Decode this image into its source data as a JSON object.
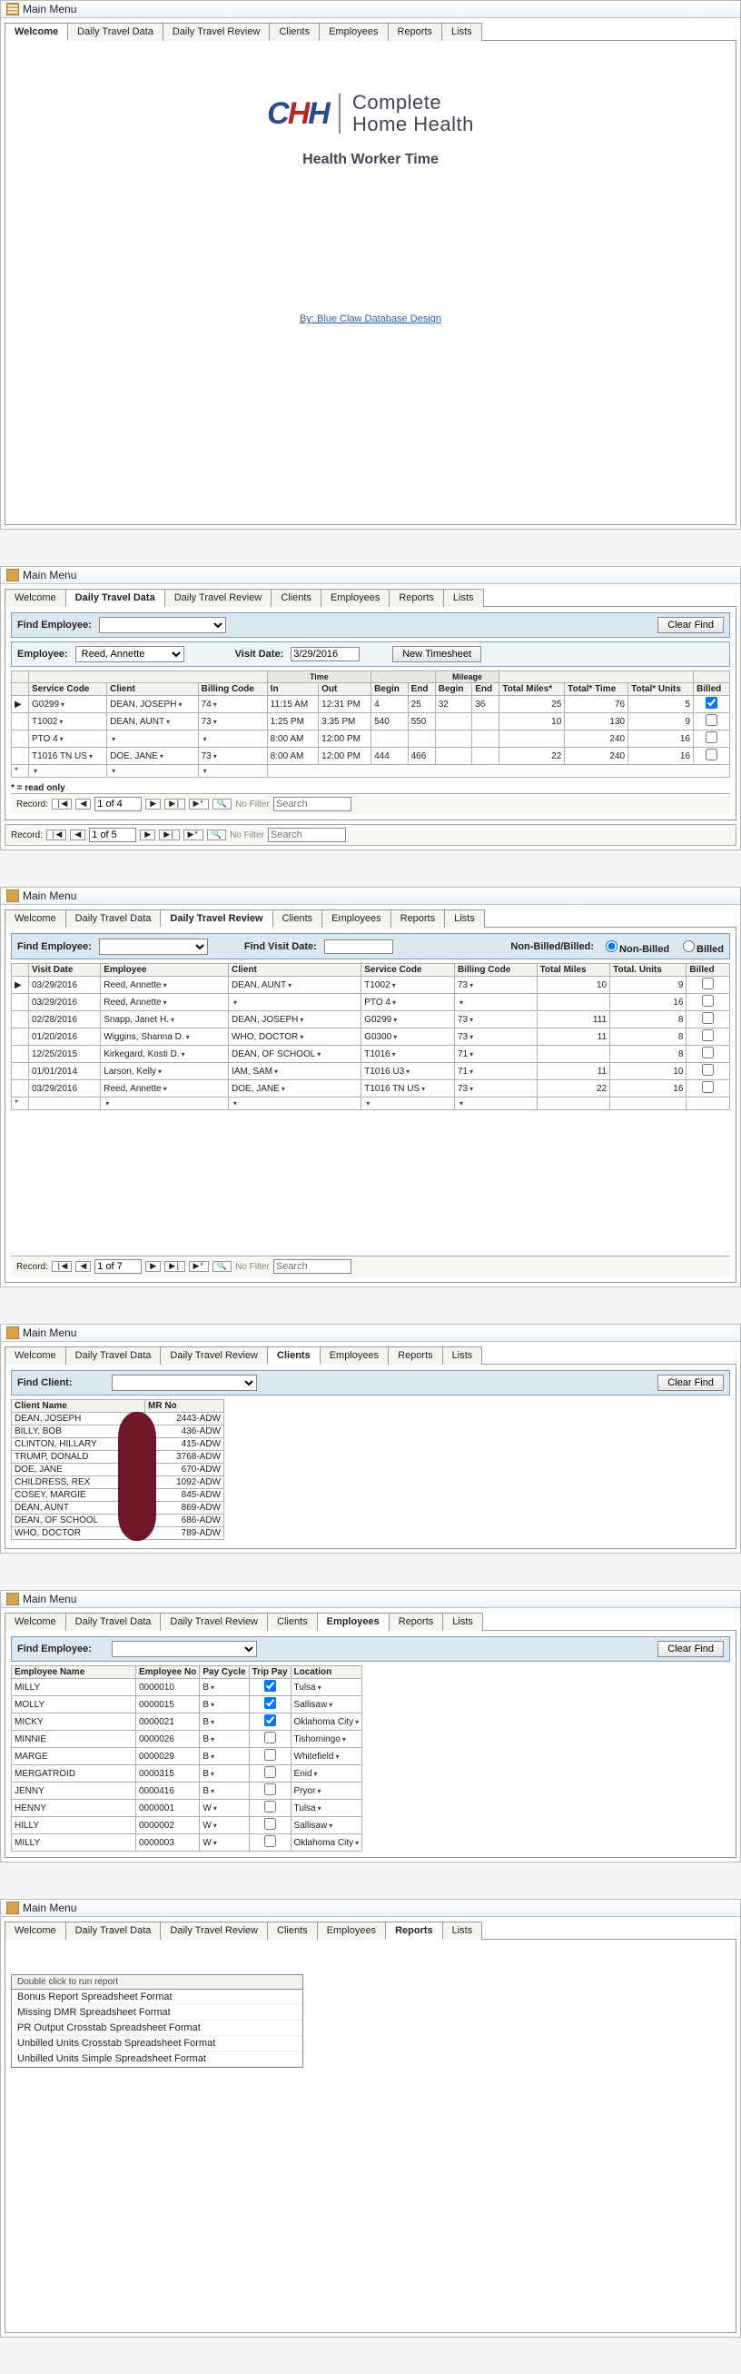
{
  "window_title": "Main Menu",
  "tabs": [
    "Welcome",
    "Daily Travel Data",
    "Daily Travel Review",
    "Clients",
    "Employees",
    "Reports",
    "Lists"
  ],
  "welcome": {
    "brand_line1": "Complete",
    "brand_line2": "Home Health",
    "subtitle": "Health Worker Time",
    "credit": "By: Blue Claw Database Design"
  },
  "daily_travel_data": {
    "find_label": "Find Employee:",
    "clear_btn": "Clear Find",
    "employee_label": "Employee:",
    "employee_value": "Reed, Annette",
    "visit_date_label": "Visit Date:",
    "visit_date_value": "3/29/2016",
    "new_btn": "New Timesheet",
    "group_headers": [
      "",
      "",
      "",
      "",
      "Time",
      "",
      "Mileage",
      "",
      "",
      "",
      ""
    ],
    "headers": [
      "Service Code",
      "Client",
      "Billing Code",
      "In",
      "Out",
      "Begin",
      "End",
      "Begin",
      "End",
      "Total Miles*",
      "Total* Time",
      "Total* Units",
      "Billed"
    ],
    "rows": [
      {
        "svc": "G0299",
        "client": "DEAN, JOSEPH",
        "bill": "74",
        "in": "11:15 AM",
        "out": "12:31 PM",
        "tb": "4",
        "te": "25",
        "mb": "32",
        "me": "36",
        "miles": "25",
        "time": "76",
        "units": "5",
        "billed": true
      },
      {
        "svc": "T1002",
        "client": "DEAN, AUNT",
        "bill": "73",
        "in": "1:25 PM",
        "out": "3:35 PM",
        "tb": "540",
        "te": "550",
        "mb": "",
        "me": "",
        "miles": "10",
        "time": "130",
        "units": "9",
        "billed": false
      },
      {
        "svc": "PTO 4",
        "client": "",
        "bill": "",
        "in": "8:00 AM",
        "out": "12:00 PM",
        "tb": "",
        "te": "",
        "mb": "",
        "me": "",
        "miles": "",
        "time": "240",
        "units": "16",
        "billed": false
      },
      {
        "svc": "T1016 TN US",
        "client": "DOE, JANE",
        "bill": "73",
        "in": "8:00 AM",
        "out": "12:00 PM",
        "tb": "444",
        "te": "466",
        "mb": "",
        "me": "",
        "miles": "22",
        "time": "240",
        "units": "16",
        "billed": false
      }
    ],
    "readonly_note": "* = read only",
    "nav1": "1 of 4",
    "nav2": "1 of 5",
    "nofilter": "No Filter",
    "search": "Search"
  },
  "daily_travel_review": {
    "find_label": "Find Employee:",
    "find_visit": "Find Visit Date:",
    "status_label": "Non-Billed/Billed:",
    "status_opts": [
      "Non-Billed",
      "Billed"
    ],
    "headers": [
      "Visit Date",
      "Employee",
      "Client",
      "Service Code",
      "Billing Code",
      "Total Miles",
      "Total. Units",
      "Billed"
    ],
    "rows": [
      {
        "d": "03/29/2016",
        "e": "Reed, Annette",
        "c": "DEAN, AUNT",
        "s": "T1002",
        "b": "73",
        "m": "10",
        "u": "9",
        "x": false
      },
      {
        "d": "03/29/2016",
        "e": "Reed, Annette",
        "c": "",
        "s": "PTO 4",
        "b": "",
        "m": "",
        "u": "16",
        "x": false
      },
      {
        "d": "02/28/2016",
        "e": "Snapp, Janet H.",
        "c": "DEAN, JOSEPH",
        "s": "G0299",
        "b": "73",
        "m": "111",
        "u": "8",
        "x": false
      },
      {
        "d": "01/20/2016",
        "e": "Wiggins, Shanna D.",
        "c": "WHO, DOCTOR",
        "s": "G0300",
        "b": "73",
        "m": "11",
        "u": "8",
        "x": false
      },
      {
        "d": "12/25/2015",
        "e": "Kirkegard, Kosti D.",
        "c": "DEAN, OF SCHOOL",
        "s": "T1016",
        "b": "71",
        "m": "",
        "u": "8",
        "x": false
      },
      {
        "d": "01/01/2014",
        "e": "Larson, Kelly",
        "c": "IAM, SAM",
        "s": "T1016 U3",
        "b": "71",
        "m": "11",
        "u": "10",
        "x": false
      },
      {
        "d": "03/29/2016",
        "e": "Reed, Annette",
        "c": "DOE, JANE",
        "s": "T1016 TN US",
        "b": "73",
        "m": "22",
        "u": "16",
        "x": false
      }
    ],
    "nav": "1 of 7"
  },
  "clients": {
    "find_label": "Find Client:",
    "clear_btn": "Clear Find",
    "headers": [
      "Client Name",
      "MR No"
    ],
    "rows": [
      {
        "n": "DEAN, JOSEPH",
        "m": "2443-ADW"
      },
      {
        "n": "BILLY, BOB",
        "m": "436-ADW"
      },
      {
        "n": "CLINTON, HILLARY",
        "m": "415-ADW"
      },
      {
        "n": "TRUMP, DONALD",
        "m": "3768-ADW"
      },
      {
        "n": "DOE, JANE",
        "m": "670-ADW"
      },
      {
        "n": "CHILDRESS, REX",
        "m": "1092-ADW"
      },
      {
        "n": "COSEY, MARGIE",
        "m": "845-ADW"
      },
      {
        "n": "DEAN, AUNT",
        "m": "869-ADW"
      },
      {
        "n": "DEAN, OF SCHOOL",
        "m": "686-ADW"
      },
      {
        "n": "WHO, DOCTOR",
        "m": "789-ADW"
      }
    ]
  },
  "employees": {
    "find_label": "Find Employee:",
    "clear_btn": "Clear Find",
    "headers": [
      "Employee Name",
      "Employee No",
      "Pay Cycle",
      "Trip Pay",
      "Location"
    ],
    "rows": [
      {
        "n": "MILLY",
        "no": "0000010",
        "pc": "B",
        "tp": true,
        "loc": "Tulsa"
      },
      {
        "n": "MOLLY",
        "no": "0000015",
        "pc": "B",
        "tp": true,
        "loc": "Sallisaw"
      },
      {
        "n": "MICKY",
        "no": "0000021",
        "pc": "B",
        "tp": true,
        "loc": "Oklahoma City"
      },
      {
        "n": "MINNIE",
        "no": "0000026",
        "pc": "B",
        "tp": false,
        "loc": "Tishomingo"
      },
      {
        "n": "MARGE",
        "no": "0000029",
        "pc": "B",
        "tp": false,
        "loc": "Whitefield"
      },
      {
        "n": "MERGATROID",
        "no": "0000315",
        "pc": "B",
        "tp": false,
        "loc": "Enid"
      },
      {
        "n": "JENNY",
        "no": "0000416",
        "pc": "B",
        "tp": false,
        "loc": "Pryor"
      },
      {
        "n": "HENNY",
        "no": "0000001",
        "pc": "W",
        "tp": false,
        "loc": "Tulsa"
      },
      {
        "n": "HILLY",
        "no": "0000002",
        "pc": "W",
        "tp": false,
        "loc": "Sallisaw"
      },
      {
        "n": "MILLY",
        "no": "0000003",
        "pc": "W",
        "tp": false,
        "loc": "Oklahoma City"
      }
    ]
  },
  "reports": {
    "hint": "Double click to run report",
    "items": [
      "Bonus Report Spreadsheet Format",
      "Missing DMR Spreadsheet Format",
      "PR Output Crosstab Spreadsheet Format",
      "Unbilled Units Crosstab  Spreadsheet Format",
      "Unbilled Units Simple  Spreadsheet Format"
    ]
  },
  "nav_labels": {
    "record": "Record:",
    "first": "|◀",
    "prev": "◀",
    "next": "▶",
    "last": "▶|",
    "new": "▶*"
  }
}
